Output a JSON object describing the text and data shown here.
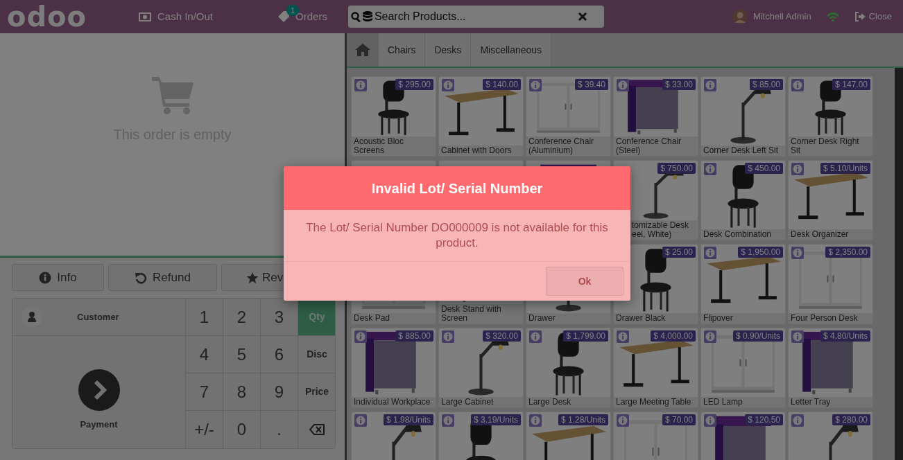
{
  "header": {
    "logo": "odoo",
    "cash_button": "Cash In/Out",
    "orders_button": {
      "label": "Orders",
      "badge": "1"
    },
    "search": {
      "placeholder": "Search Products..."
    },
    "user": "Mitchell Admin",
    "close_button": "Close"
  },
  "order": {
    "empty_text": "This order is empty"
  },
  "actions": [
    {
      "label": "Info",
      "kind": "full"
    },
    {
      "label": "Refund",
      "kind": "full"
    },
    {
      "label": "Rev",
      "kind": "cut"
    }
  ],
  "customer_button": "Customer",
  "payment_button": "Payment",
  "numpad": [
    {
      "kind": "digit",
      "label": "1"
    },
    {
      "kind": "digit",
      "label": "2"
    },
    {
      "kind": "digit",
      "label": "3"
    },
    {
      "kind": "mode",
      "label": "Qty",
      "selected": true
    },
    {
      "kind": "digit",
      "label": "4"
    },
    {
      "kind": "digit",
      "label": "5"
    },
    {
      "kind": "digit",
      "label": "6"
    },
    {
      "kind": "mode",
      "label": "Disc",
      "selected": false
    },
    {
      "kind": "digit",
      "label": "7"
    },
    {
      "kind": "digit",
      "label": "8"
    },
    {
      "kind": "digit",
      "label": "9"
    },
    {
      "kind": "mode",
      "label": "Price",
      "selected": false
    },
    {
      "kind": "digit",
      "label": "+/-"
    },
    {
      "kind": "digit",
      "label": "0"
    },
    {
      "kind": "digit",
      "label": "."
    },
    {
      "kind": "backspace"
    }
  ],
  "categories": [
    "Chairs",
    "Desks",
    "Miscellaneous"
  ],
  "products": [
    {
      "kind": "full",
      "name": "Acoustic Bloc Screens",
      "price": "$ 295.00"
    },
    {
      "kind": "full",
      "name": "Cabinet with Doors",
      "price": "$ 140.00"
    },
    {
      "kind": "full",
      "name": "Conference Chair (Aluminium)",
      "price": "$ 39.40"
    },
    {
      "kind": "full",
      "name": "Conference Chair (Steel)",
      "price": "$ 33.00"
    },
    {
      "kind": "full",
      "name": "Corner Desk Left Sit",
      "price": "$ 85.00"
    },
    {
      "kind": "full",
      "name": "Corner Desk Right Sit",
      "price": "$ 147.00"
    },
    {
      "kind": "covered"
    },
    {
      "kind": "covered"
    },
    {
      "kind": "covered"
    },
    {
      "kind": "cut",
      "name": "tomizable Desk\neel, White)",
      "price": "$ 750.00"
    },
    {
      "kind": "full",
      "name": "Desk Combination",
      "price": "$ 450.00"
    },
    {
      "kind": "full",
      "name": "Desk Organizer",
      "price": "$ 5.10/Units"
    },
    {
      "kind": "covered",
      "name": "Desk Pad"
    },
    {
      "kind": "covered",
      "name": "Desk Stand with Screen"
    },
    {
      "kind": "covered",
      "name": "Drawer"
    },
    {
      "kind": "covered",
      "name": "Drawer Black",
      "price": "$ 25.00"
    },
    {
      "kind": "full",
      "name": "Flipover",
      "price": "$ 1,950.00"
    },
    {
      "kind": "full",
      "name": "Four Person Desk",
      "price": "$ 2,350.00"
    },
    {
      "kind": "full",
      "name": "Individual Workplace",
      "price": "$ 885.00"
    },
    {
      "kind": "full",
      "name": "Large Cabinet",
      "price": "$ 320.00"
    },
    {
      "kind": "full",
      "name": "Large Desk",
      "price": "$ 1,799.00"
    },
    {
      "kind": "full",
      "name": "Large Meeting Table",
      "price": "$ 4,000.00"
    },
    {
      "kind": "full",
      "name": "LED Lamp",
      "price": "$ 0.90/Units"
    },
    {
      "kind": "full",
      "name": "Letter Tray",
      "price": "$ 4.80/Units"
    },
    {
      "kind": "full",
      "price": "$ 1.98/Units"
    },
    {
      "kind": "full",
      "price": "$ 3.19/Units"
    },
    {
      "kind": "full",
      "price": "$ 1.28/Units"
    },
    {
      "kind": "full",
      "price": "$ 70.00"
    },
    {
      "kind": "full",
      "price": "$ 120.50"
    },
    {
      "kind": "full",
      "price": "$ 280.00"
    }
  ],
  "dialog": {
    "title": "Invalid Lot/ Serial Number",
    "message": "The Lot/ Serial Number DO000009 is not available for this product.",
    "button": "Ok"
  }
}
